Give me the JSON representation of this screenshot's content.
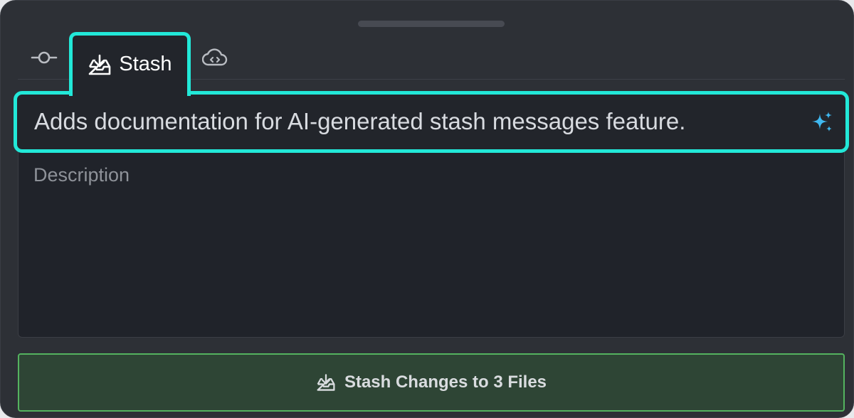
{
  "tabs": [
    {
      "icon": "commit-icon",
      "label": ""
    },
    {
      "icon": "stash-icon",
      "label": "Stash",
      "active": true
    },
    {
      "icon": "cloud-patch-icon",
      "label": ""
    }
  ],
  "message": {
    "value": "Adds documentation for AI-generated stash messages feature.",
    "icon": "sparkle-icon"
  },
  "description": {
    "placeholder": "Description",
    "value": ""
  },
  "stash_button": {
    "label": "Stash Changes to 3 Files",
    "icon": "stash-icon"
  },
  "colors": {
    "highlight": "#22e8d8",
    "sparkle": "#3fb8f0",
    "button_bg": "#2e4535",
    "button_border": "#54b35f"
  }
}
